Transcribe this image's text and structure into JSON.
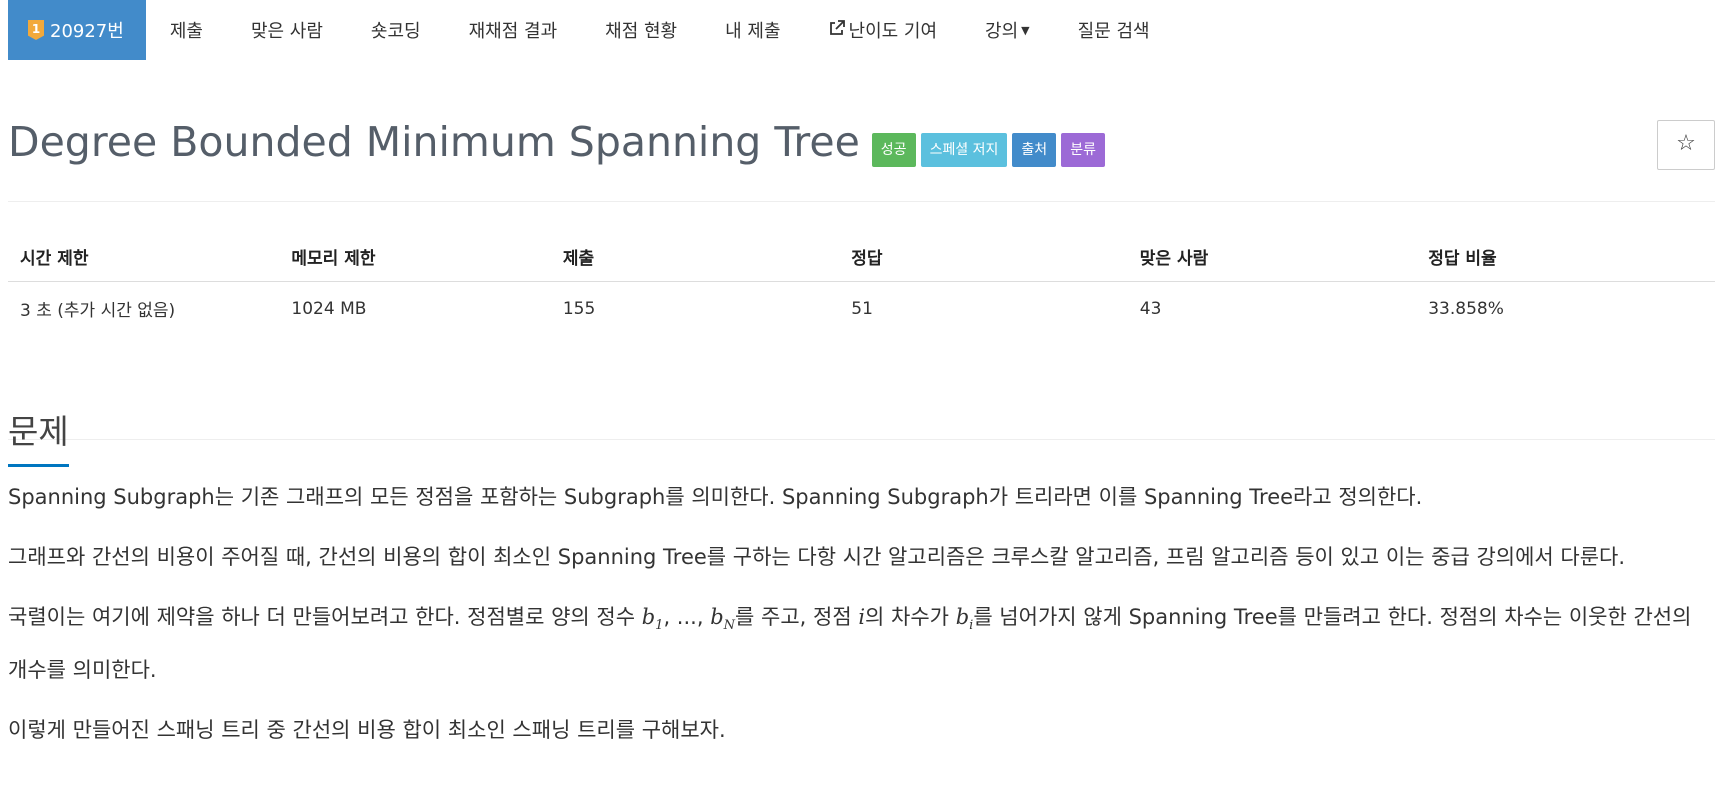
{
  "nav": {
    "problem_id": "20927번",
    "tier_badge": "1",
    "items": [
      "제출",
      "맞은 사람",
      "숏코딩",
      "재채점 결과",
      "채점 현황",
      "내 제출",
      "난이도 기여",
      "강의",
      "질문 검색"
    ]
  },
  "title": "Degree Bounded Minimum Spanning Tree",
  "labels": [
    "성공",
    "스페셜 저지",
    "출처",
    "분류"
  ],
  "star": "☆",
  "table": {
    "headers": [
      "시간 제한",
      "메모리 제한",
      "제출",
      "정답",
      "맞은 사람",
      "정답 비율"
    ],
    "row": [
      "3 초 (추가 시간 없음)",
      "1024 MB",
      "155",
      "51",
      "43",
      "33.858%"
    ]
  },
  "section_title": "문제",
  "problem": {
    "p1": "Spanning Subgraph는 기존 그래프의 모든 정점을 포함하는 Subgraph를 의미한다. Spanning Subgraph가 트리라면 이를 Spanning Tree라고 정의한다.",
    "p2": "그래프와 간선의 비용이 주어질 때, 간선의 비용의 합이 최소인 Spanning Tree를 구하는 다항 시간 알고리즘은 크루스칼 알고리즘, 프림 알고리즘 등이 있고 이는 중급 강의에서 다룬다.",
    "p3_a": "국렬이는 여기에 제약을 하나 더 만들어보려고 한다. 정점별로 양의 정수 ",
    "p3_b1": "b",
    "p3_sub1": "1",
    "p3_c": ", ..., ",
    "p3_b2": "b",
    "p3_sub2": "N",
    "p3_d": "를 주고, 정점 ",
    "p3_i": "i",
    "p3_e": "의 차수가 ",
    "p3_b3": "b",
    "p3_sub3": "i",
    "p3_f": "를 넘어가지 않게 Spanning Tree를 만들려고 한다. 정점의 차수는 이웃한 간선의 개수를 의미한다.",
    "p4": "이렇게 만들어진 스패닝 트리 중 간선의 비용 합이 최소인 스패닝 트리를 구해보자."
  }
}
